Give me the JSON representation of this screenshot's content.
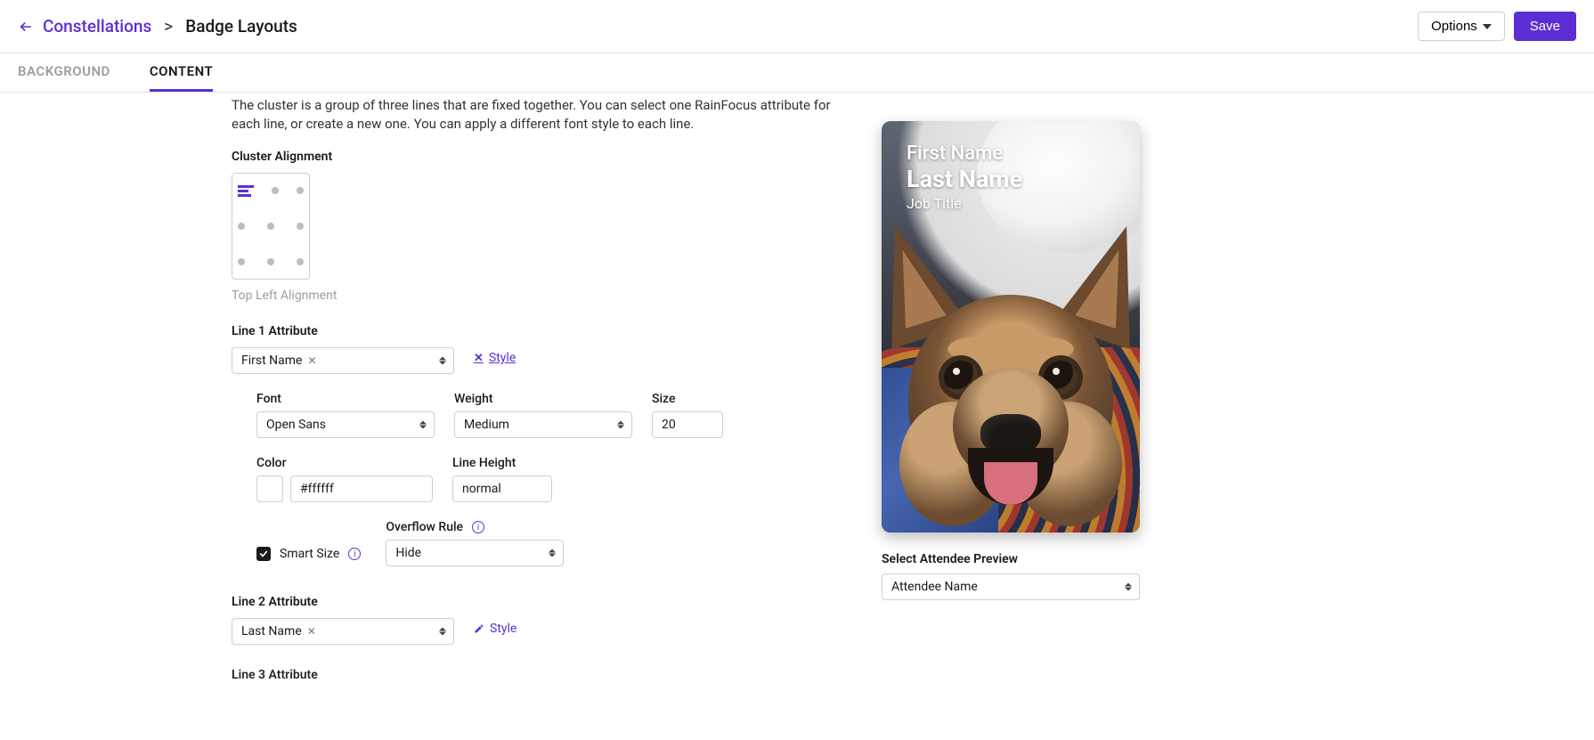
{
  "header": {
    "crumb_link": "Constellations",
    "crumb_sep": ">",
    "crumb_current": "Badge Layouts",
    "options_label": "Options",
    "save_label": "Save"
  },
  "tabs": {
    "background": "BACKGROUND",
    "content": "CONTENT"
  },
  "cluster": {
    "description": "The cluster is a group of three lines that are fixed together. You can select one RainFocus attribute for each line, or create a new one. You can apply a different font style to each line.",
    "alignment_label": "Cluster Alignment",
    "alignment_caption": "Top Left Alignment"
  },
  "line1": {
    "label": "Line 1 Attribute",
    "value": "First Name",
    "style_link": "Style",
    "font_label": "Font",
    "font_value": "Open Sans",
    "weight_label": "Weight",
    "weight_value": "Medium",
    "size_label": "Size",
    "size_value": "20",
    "color_label": "Color",
    "color_value": "#ffffff",
    "lh_label": "Line Height",
    "lh_value": "normal",
    "smart_size_label": "Smart Size",
    "overflow_label": "Overflow Rule",
    "overflow_value": "Hide"
  },
  "line2": {
    "label": "Line 2 Attribute",
    "value": "Last Name",
    "style_link": "Style"
  },
  "line3": {
    "label": "Line 3 Attribute"
  },
  "preview": {
    "line1": "First Name",
    "line2": "Last Name",
    "line3": "Job Title",
    "select_label": "Select Attendee Preview",
    "select_value": "Attendee Name"
  }
}
